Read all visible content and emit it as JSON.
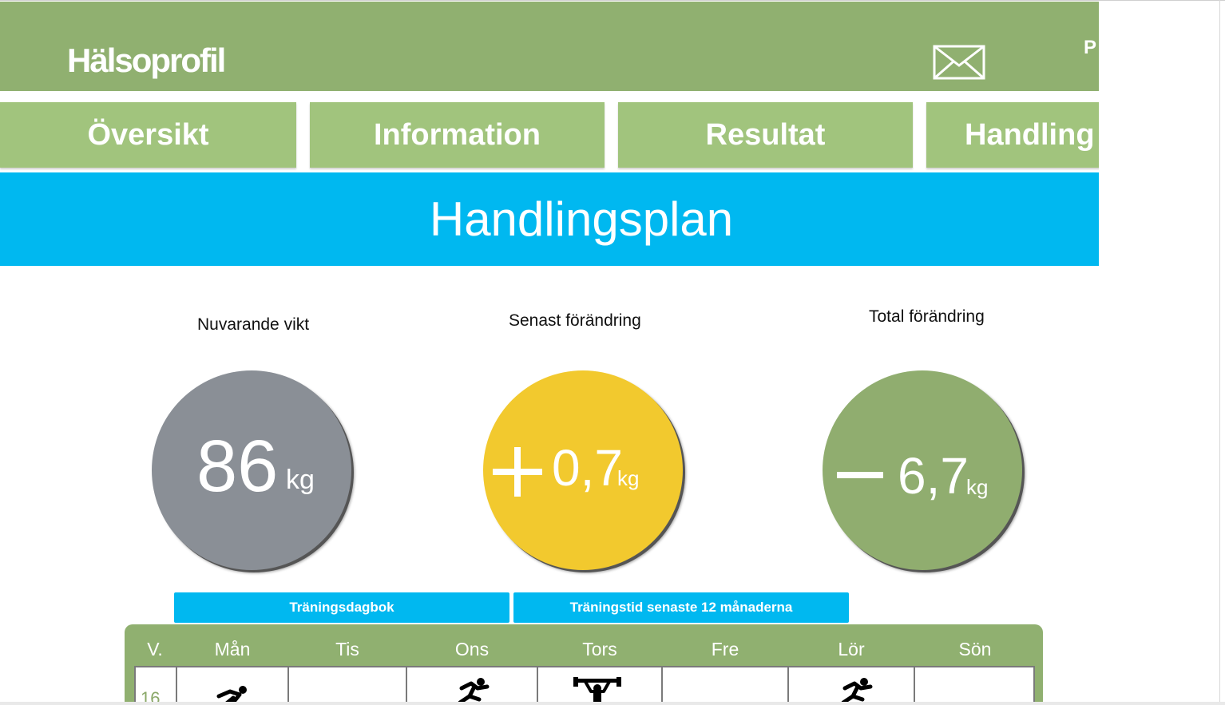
{
  "header": {
    "title": "Hälsoprofil",
    "cut_text": "P",
    "mail_icon": "mail-icon"
  },
  "nav": {
    "tabs": [
      {
        "label": "Översikt"
      },
      {
        "label": "Information"
      },
      {
        "label": "Resultat"
      },
      {
        "label": "Handling"
      }
    ]
  },
  "page": {
    "title": "Handlingsplan"
  },
  "stats": {
    "current_weight": {
      "label": "Nuvarande vikt",
      "value": "86",
      "unit": "kg",
      "color": "#8a8f96"
    },
    "latest_change": {
      "label": "Senast förändring",
      "sign": "+",
      "value": "0,7",
      "unit": "kg",
      "color": "#f2c92e"
    },
    "total_change": {
      "label": "Total förändring",
      "sign": "−",
      "value": "6,7",
      "unit": "kg",
      "color": "#90ad6f"
    }
  },
  "subtabs": [
    {
      "label": "Träningsdagbok"
    },
    {
      "label": "Träningstid senaste 12 månaderna"
    }
  ],
  "calendar": {
    "week_header": "V.",
    "days": [
      "Mån",
      "Tis",
      "Ons",
      "Tors",
      "Fre",
      "Lör",
      "Sön"
    ],
    "rows": [
      {
        "week": "16",
        "icons": [
          "running-icon",
          "",
          "running-icon",
          "weightlifting-icon",
          "",
          "running-icon",
          ""
        ]
      }
    ]
  },
  "colors": {
    "header": "#90b070",
    "tab": "#a1c47d",
    "banner": "#00b8f0"
  }
}
